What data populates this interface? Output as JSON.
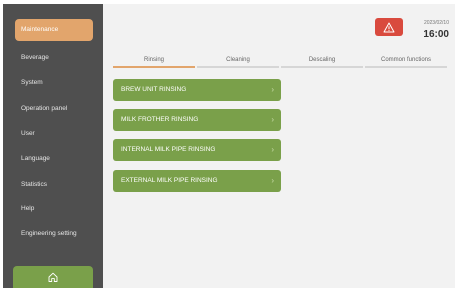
{
  "sidebar": {
    "items": [
      {
        "label": "Maintenance",
        "active": true
      },
      {
        "label": "Beverage"
      },
      {
        "label": "System"
      },
      {
        "label": "Operation panel"
      },
      {
        "label": "User"
      },
      {
        "label": "Language"
      },
      {
        "label": "Statistics"
      },
      {
        "label": "Help"
      },
      {
        "label": "Engineering setting"
      }
    ],
    "home_icon": "home-icon"
  },
  "header": {
    "warning_icon": "warning-icon",
    "date": "2023/02/10",
    "time": "16:00"
  },
  "tabs": [
    {
      "label": "Rinsing",
      "active": true
    },
    {
      "label": "Cleaning"
    },
    {
      "label": "Descaling"
    },
    {
      "label": "Common functions"
    }
  ],
  "actions": [
    {
      "label": "BREW UNIT RINSING"
    },
    {
      "label": "MILK FROTHER RINSING"
    },
    {
      "label": "INTERNAL MILK PIPE RINSING"
    },
    {
      "label": "EXTERNAL MILK PIPE RINSING"
    }
  ],
  "colors": {
    "sidebar_bg": "#4f4f4f",
    "active_accent": "#e2a56c",
    "button_green": "#7aa04a",
    "warning_red": "#d94a3e"
  }
}
